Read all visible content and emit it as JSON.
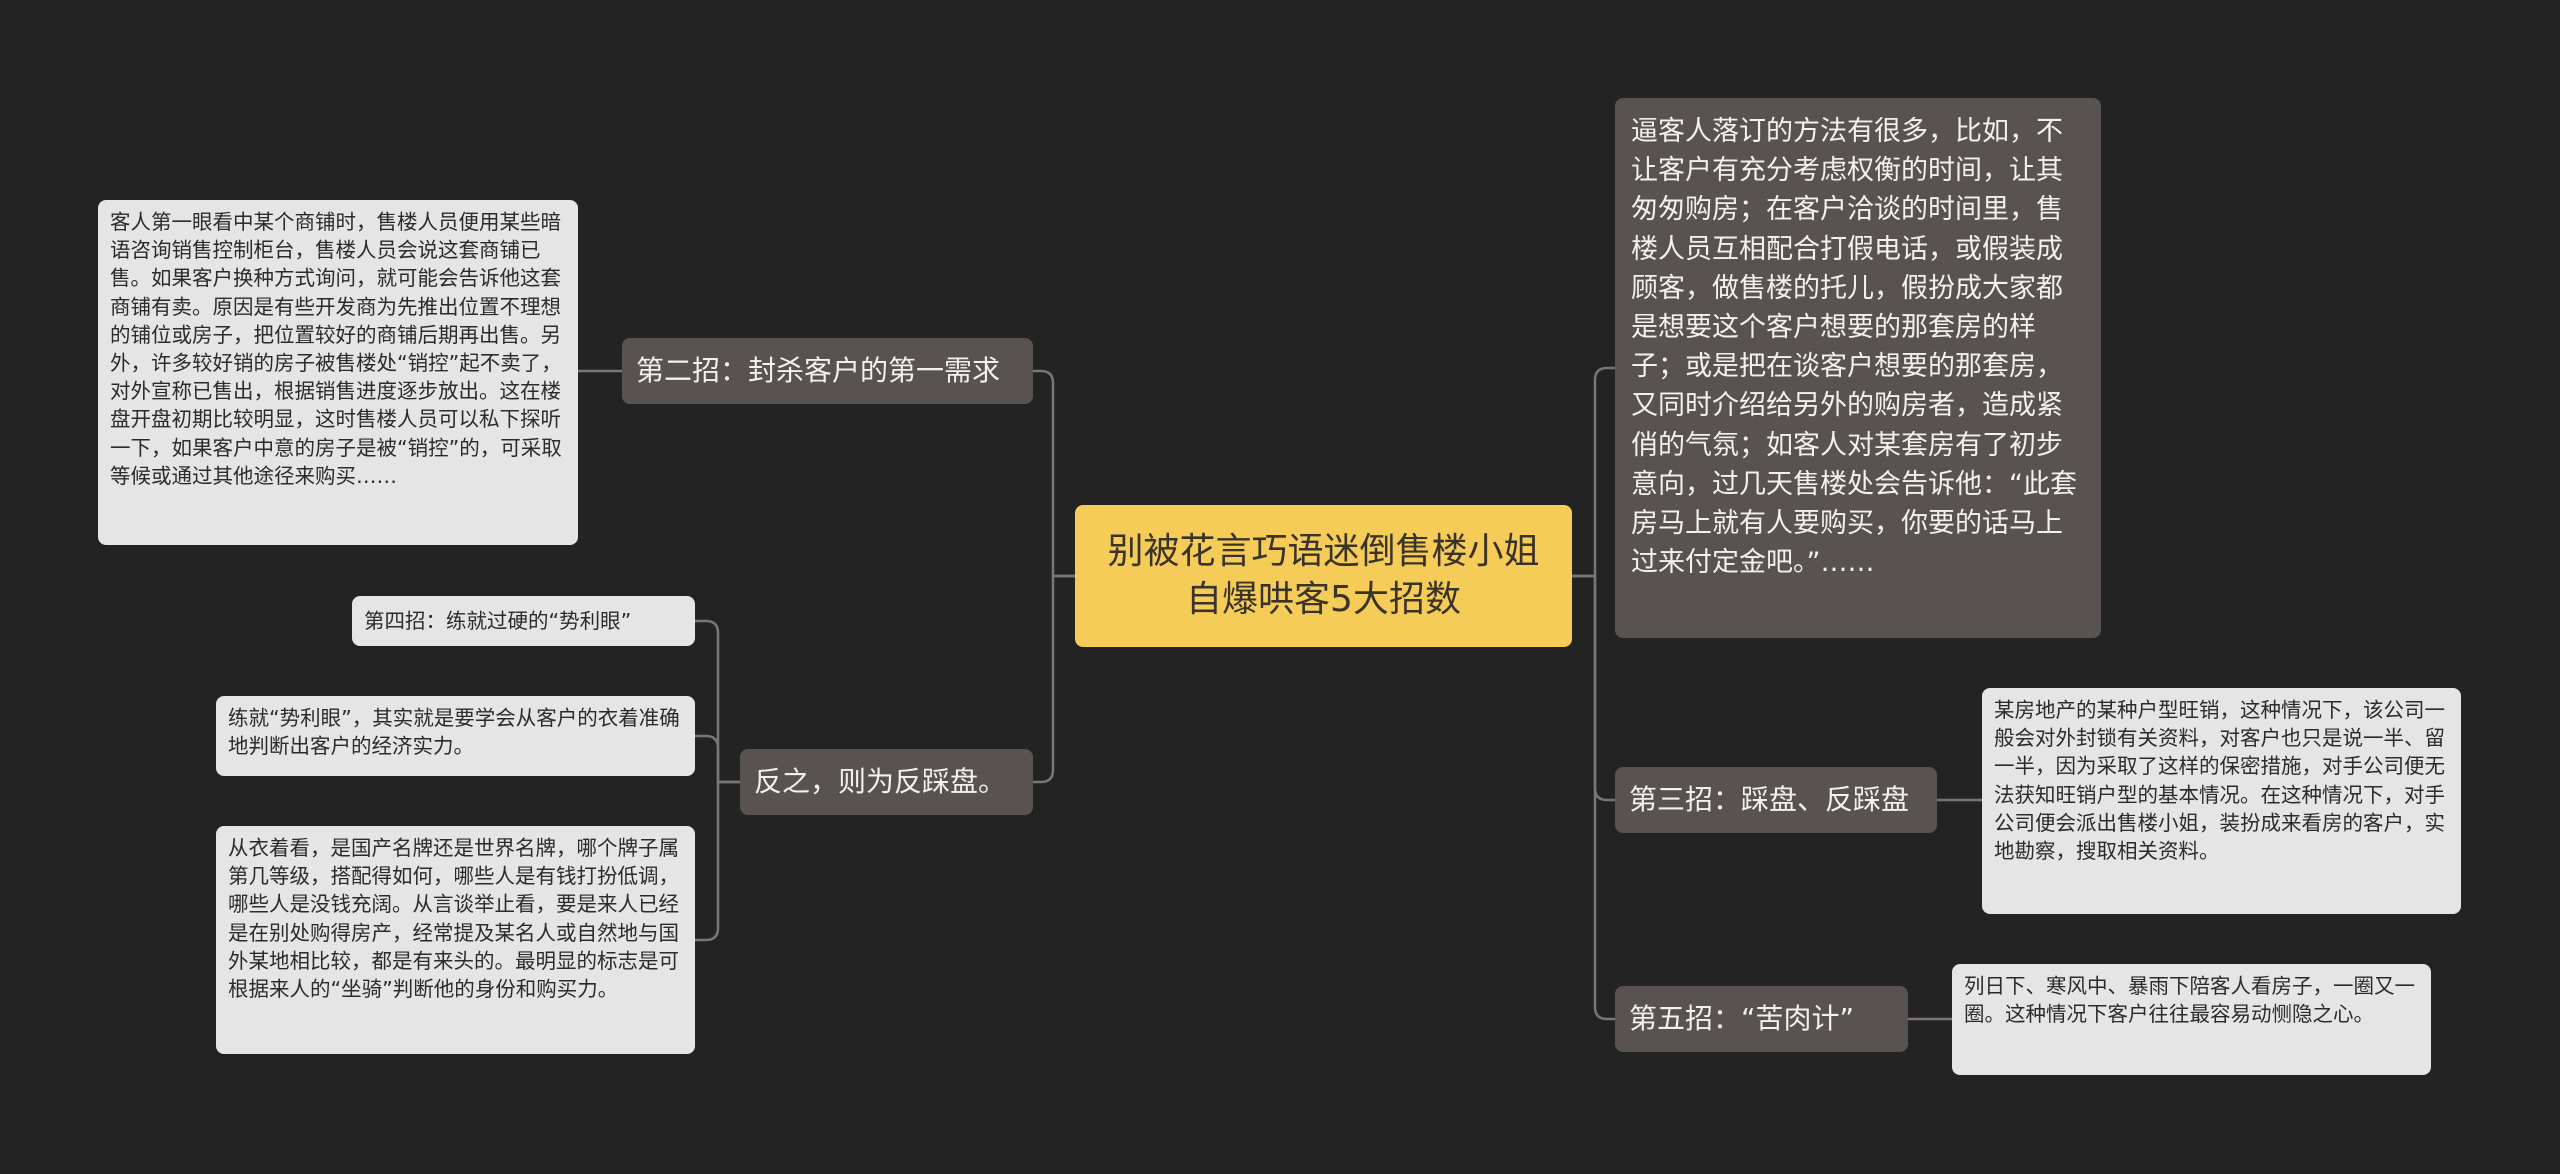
{
  "root": {
    "title": "别被花言巧语迷倒售楼小姐自爆哄客5大招数"
  },
  "left": [
    {
      "topic": "第二招：封杀客户的第一需求",
      "notes": [
        "客人第一眼看中某个商铺时，售楼人员便用某些暗语咨询销售控制柜台，售楼人员会说这套商铺已售。如果客户换种方式询问，就可能会告诉他这套商铺有卖。原因是有些开发商为先推出位置不理想的铺位或房子，把位置较好的商铺后期再出售。另外，许多较好销的房子被售楼处“销控”起不卖了，对外宣称已售出，根据销售进度逐步放出。这在楼盘开盘初期比较明显，这时售楼人员可以私下探听一下，如果客户中意的房子是被“销控”的，可采取等候或通过其他途径来购买……"
      ]
    },
    {
      "topic": "反之，则为反踩盘。",
      "notes": [
        "第四招：练就过硬的“势利眼”",
        "练就“势利眼”，其实就是要学会从客户的衣着准确地判断出客户的经济实力。",
        "从衣着看，是国产名牌还是世界名牌，哪个牌子属第几等级，搭配得如何，哪些人是有钱打扮低调，哪些人是没钱充阔。从言谈举止看，要是来人已经是在别处购得房产，经常提及某名人或自然地与国外某地相比较，都是有来头的。最明显的标志是可根据来人的“坐骑”判断他的身份和购买力。"
      ]
    }
  ],
  "right": [
    {
      "topic": "逼客人落订的方法有很多，比如，不让客户有充分考虑权衡的时间，让其匆匆购房；在客户洽谈的时间里，售楼人员互相配合打假电话，或假装成顾客，做售楼的托儿，假扮成大家都是想要这个客户想要的那套房的样子；或是把在谈客户想要的那套房，又同时介绍给另外的购房者，造成紧俏的气氛；如客人对某套房有了初步意向，过几天售楼处会告诉他：“此套房马上就有人要购买，你要的话马上过来付定金吧。”……",
      "notes": []
    },
    {
      "topic": "第三招：踩盘、反踩盘",
      "notes": [
        "某房地产的某种户型旺销，这种情况下，该公司一般会对外封锁有关资料，对客户也只是说一半、留一半，因为采取了这样的保密措施，对手公司便无法获知旺销户型的基本情况。在这种情况下，对手公司便会派出售楼小姐，装扮成来看房的客户，实地勘察，搜取相关资料。"
      ]
    },
    {
      "topic": "第五招：“苦肉计”",
      "notes": [
        "列日下、寒风中、暴雨下陪客人看房子，一圈又一圈。这种情况下客户往往最容易动恻隐之心。"
      ]
    }
  ],
  "colors": {
    "background": "#232323",
    "root": "#f6cc58",
    "topic": "#585350",
    "note": "#e5e5e5",
    "line": "#7a7672"
  }
}
